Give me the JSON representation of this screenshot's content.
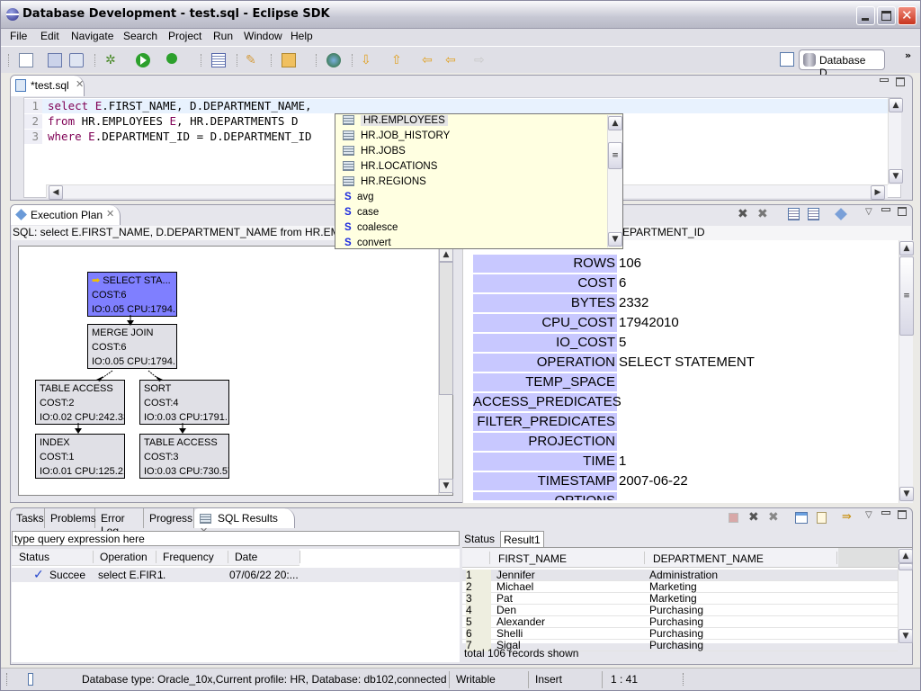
{
  "window": {
    "title": "Database Development - test.sql - Eclipse SDK"
  },
  "menubar": [
    "File",
    "Edit",
    "Navigate",
    "Search",
    "Project",
    "Run",
    "Window",
    "Help"
  ],
  "toolbar": {
    "icons": [
      "new-icon",
      "save-icon",
      "print-icon",
      "debug-icon",
      "run-icon",
      "external-tools-icon",
      "open-task-icon",
      "pencil-icon",
      "open-folder-icon",
      "globe-icon",
      "next-annotation-icon",
      "previous-annotation-icon",
      "last-edit-location-icon",
      "back-icon",
      "forward-icon"
    ],
    "perspective_label": "Database D..."
  },
  "editor": {
    "tab_label": "*test.sql",
    "lines": [
      {
        "num": "1",
        "parts": [
          {
            "t": "select ",
            "k": true
          },
          {
            "t": "E",
            "k": true
          },
          {
            "t": ".FIRST_NAME, D.DEPARTMENT_NAME,",
            "k": false
          }
        ]
      },
      {
        "num": "2",
        "parts": [
          {
            "t": "from ",
            "k": true
          },
          {
            "t": "HR.EMPLOYEES ",
            "k": false
          },
          {
            "t": "E",
            "k": true
          },
          {
            "t": ", HR.DEPARTMENTS D",
            "k": false
          }
        ]
      },
      {
        "num": "3",
        "parts": [
          {
            "t": "where ",
            "k": true
          },
          {
            "t": "E",
            "k": true
          },
          {
            "t": ".DEPARTMENT_ID = D.DEPARTMENT_ID",
            "k": false
          }
        ]
      }
    ]
  },
  "autocomplete": {
    "items": [
      {
        "label": "HR.EMPLOYEES",
        "type": "table",
        "selected": true
      },
      {
        "label": "HR.JOB_HISTORY",
        "type": "table"
      },
      {
        "label": "HR.JOBS",
        "type": "table"
      },
      {
        "label": "HR.LOCATIONS",
        "type": "table"
      },
      {
        "label": "HR.REGIONS",
        "type": "table"
      },
      {
        "label": "avg",
        "type": "function"
      },
      {
        "label": "case",
        "type": "function"
      },
      {
        "label": "coalesce",
        "type": "function"
      },
      {
        "label": "convert",
        "type": "function"
      }
    ]
  },
  "execution_plan": {
    "tab_label": "Execution Plan",
    "sql_label": "SQL: select E.FIRST_NAME, D.DEPARTMENT_NAME from HR.EMPLOY",
    "sql_label_tail": "EPARTMENT_ID",
    "nodes": [
      {
        "name": "SELECT STA...",
        "cost": "COST:6",
        "io": "IO:0.05 CPU:1794...",
        "selected": true
      },
      {
        "name": "MERGE JOIN",
        "cost": "COST:6",
        "io": "IO:0.05 CPU:1794..."
      },
      {
        "name": "TABLE ACCESS",
        "cost": "COST:2",
        "io": "IO:0.02 CPU:242.33"
      },
      {
        "name": "SORT",
        "cost": "COST:4",
        "io": "IO:0.03 CPU:1791..."
      },
      {
        "name": "INDEX",
        "cost": "COST:1",
        "io": "IO:0.01 CPU:125.21"
      },
      {
        "name": "TABLE ACCESS",
        "cost": "COST:3",
        "io": "IO:0.03 CPU:730.57"
      }
    ],
    "properties": [
      {
        "k": "ROWS",
        "v": "106"
      },
      {
        "k": "COST",
        "v": "6"
      },
      {
        "k": "BYTES",
        "v": "2332"
      },
      {
        "k": "CPU_COST",
        "v": "17942010"
      },
      {
        "k": "IO_COST",
        "v": "5"
      },
      {
        "k": "OPERATION",
        "v": "SELECT STATEMENT"
      },
      {
        "k": "TEMP_SPACE",
        "v": ""
      },
      {
        "k": "ACCESS_PREDICATES",
        "v": ""
      },
      {
        "k": "FILTER_PREDICATES",
        "v": ""
      },
      {
        "k": "PROJECTION",
        "v": ""
      },
      {
        "k": "TIME",
        "v": "1"
      },
      {
        "k": "TIMESTAMP",
        "v": "2007-06-22"
      },
      {
        "k": "OPTIONS",
        "v": ""
      }
    ]
  },
  "bottom": {
    "tabs": [
      "Tasks",
      "Problems",
      "Error Log",
      "Progress",
      "SQL Results"
    ],
    "query_placeholder": "type query expression here",
    "history_headers": [
      "Status",
      "Operation",
      "Frequency",
      "Date"
    ],
    "history_rows": [
      {
        "status": "Succee",
        "operation": "select E.FIR...",
        "frequency": "1",
        "date": "07/06/22 20:..."
      }
    ],
    "result_tabs": [
      "Status",
      "Result1"
    ],
    "result_headers": [
      "FIRST_NAME",
      "DEPARTMENT_NAME"
    ],
    "result_rows": [
      [
        "1",
        "Jennifer",
        "Administration"
      ],
      [
        "2",
        "Michael",
        "Marketing"
      ],
      [
        "3",
        "Pat",
        "Marketing"
      ],
      [
        "4",
        "Den",
        "Purchasing"
      ],
      [
        "5",
        "Alexander",
        "Purchasing"
      ],
      [
        "6",
        "Shelli",
        "Purchasing"
      ],
      [
        "7",
        "Sigal",
        "Purchasing"
      ]
    ],
    "result_footer": "total 106 records shown"
  },
  "statusbar": {
    "message": "Database type: Oracle_10x,Current profile: HR, Database: db102,connected",
    "writable": "Writable",
    "insert": "Insert",
    "position": "1 : 41"
  }
}
